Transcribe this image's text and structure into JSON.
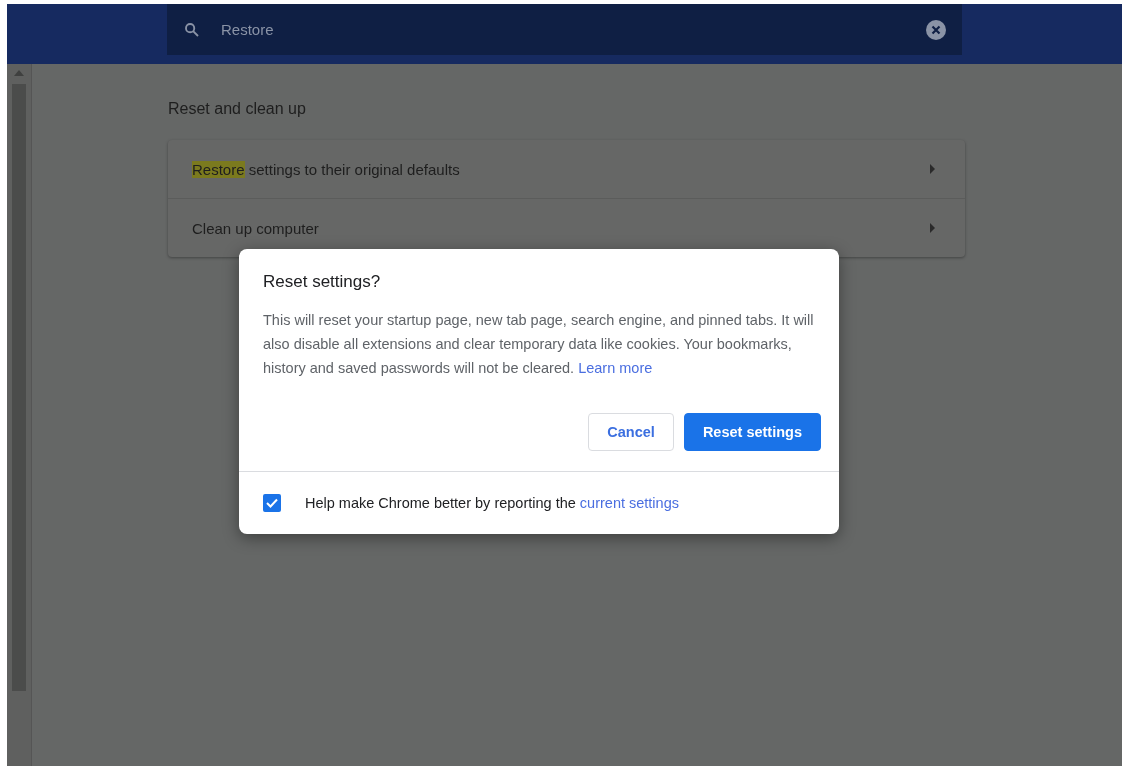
{
  "search": {
    "value": "Restore"
  },
  "section_title": "Reset and clean up",
  "rows": [
    {
      "highlight": "Restore",
      "text": " settings to their original defaults"
    },
    {
      "text": "Clean up computer"
    }
  ],
  "dialog": {
    "title": "Reset settings?",
    "body": "This will reset your startup page, new tab page, search engine, and pinned tabs. It will also disable all extensions and clear temporary data like cookies. Your bookmarks, history and saved passwords will not be cleared.",
    "link": "Learn more",
    "buttons": [
      {
        "label": "Cancel",
        "kind": "secondary"
      },
      {
        "label": "Reset settings",
        "kind": "primary"
      }
    ],
    "footer": {
      "checked": true,
      "text": "Help make Chrome better by reporting the",
      "link": "current settings"
    }
  }
}
